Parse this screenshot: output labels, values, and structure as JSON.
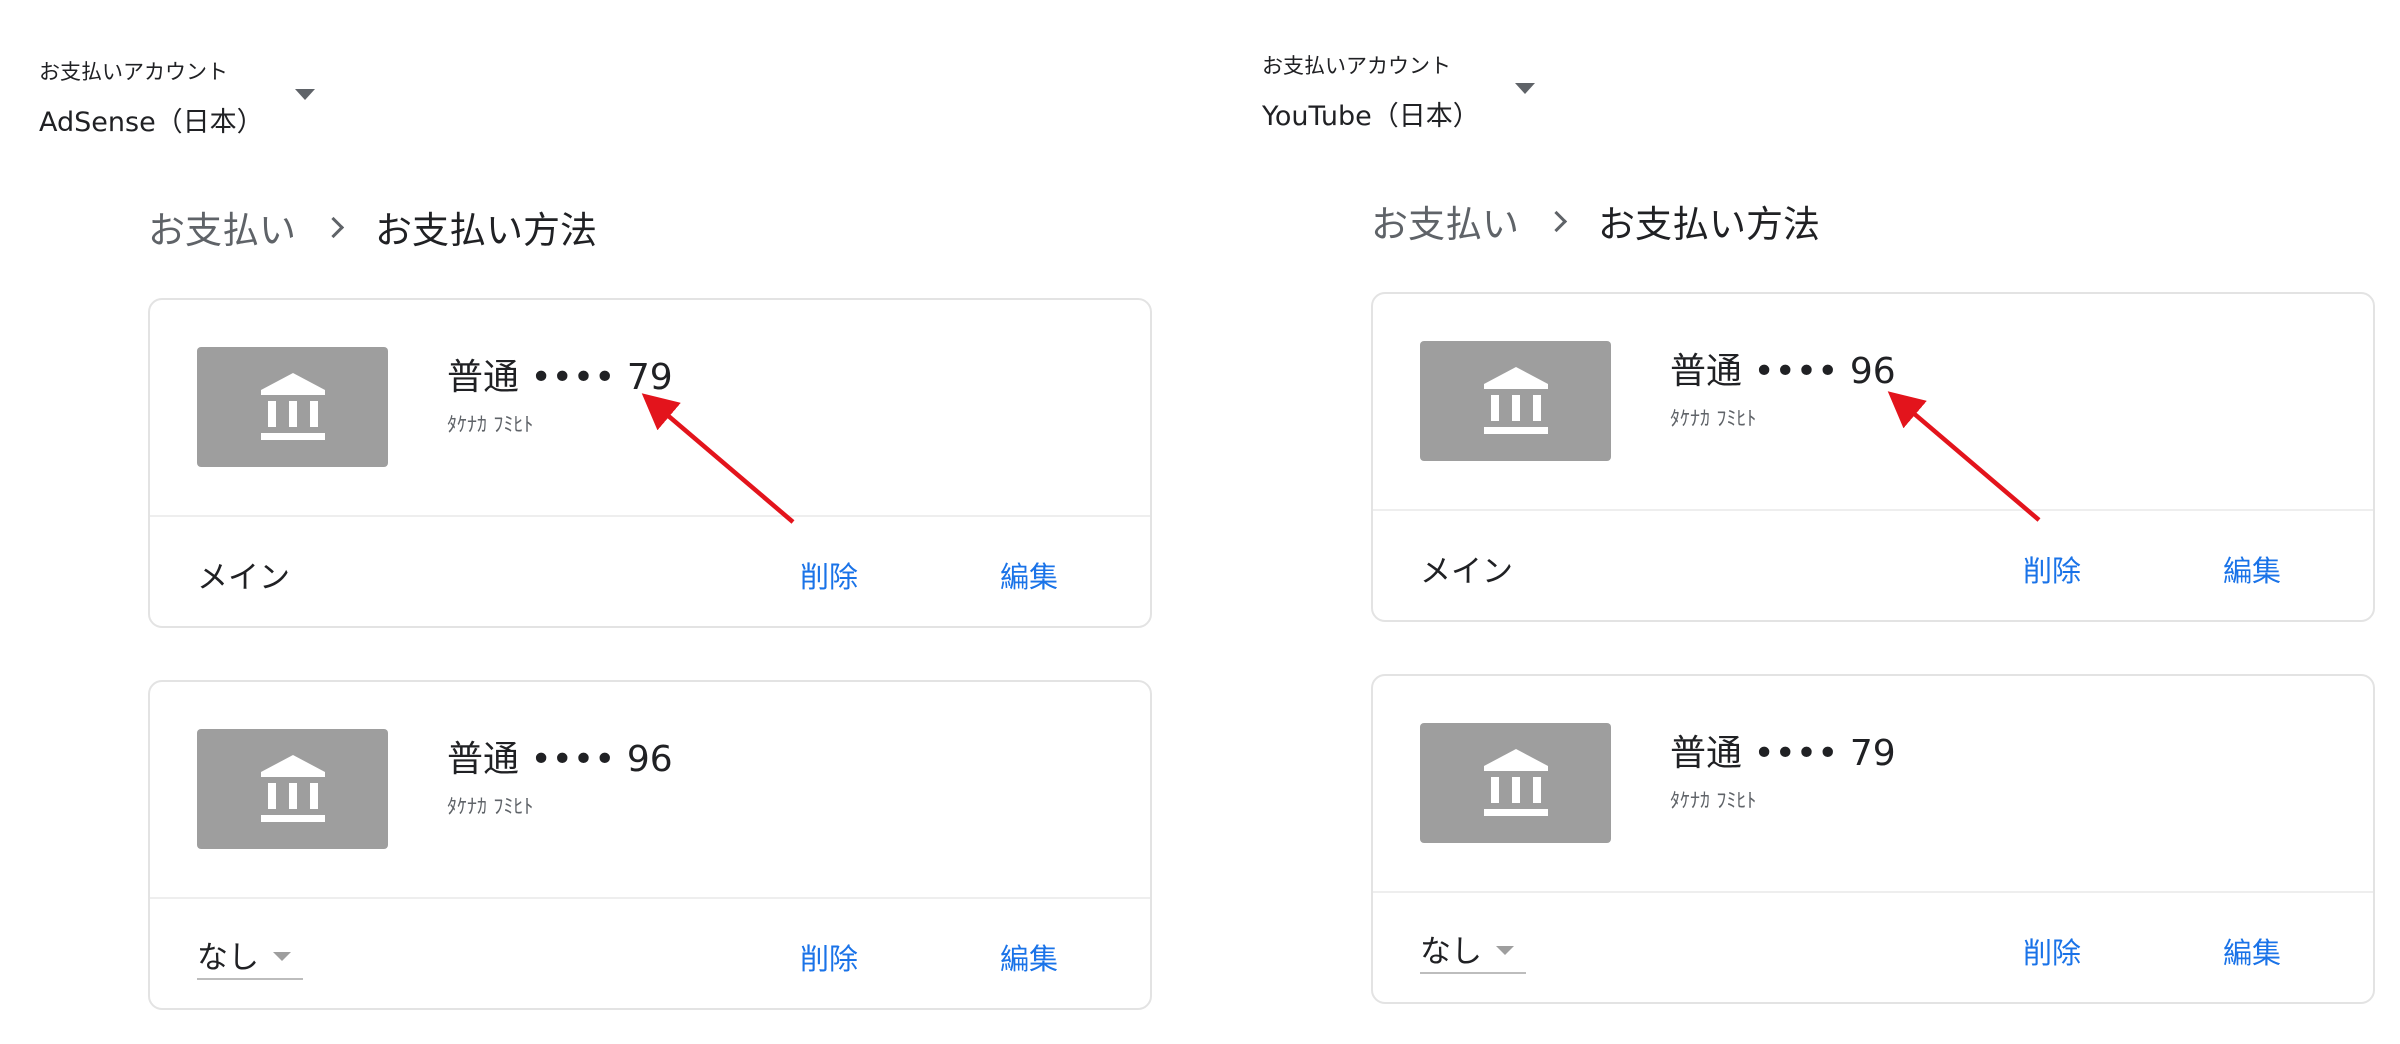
{
  "panels": [
    {
      "account_label": "お支払いアカウント",
      "account_value": "AdSense（日本）",
      "breadcrumb_root": "お支払い",
      "breadcrumb_current": "お支払い方法",
      "cards": [
        {
          "account": "普通 •••• 79",
          "holder": "ﾀｹﾅｶ ﾌﾐﾋﾄ",
          "status": "メイン",
          "delete_label": "削除",
          "edit_label": "編集"
        },
        {
          "account": "普通 •••• 96",
          "holder": "ﾀｹﾅｶ ﾌﾐﾋﾄ",
          "status": "なし",
          "delete_label": "削除",
          "edit_label": "編集"
        }
      ]
    },
    {
      "account_label": "お支払いアカウント",
      "account_value": "YouTube（日本）",
      "breadcrumb_root": "お支払い",
      "breadcrumb_current": "お支払い方法",
      "cards": [
        {
          "account": "普通 •••• 96",
          "holder": "ﾀｹﾅｶ ﾌﾐﾋﾄ",
          "status": "メイン",
          "delete_label": "削除",
          "edit_label": "編集"
        },
        {
          "account": "普通 •••• 79",
          "holder": "ﾀｹﾅｶ ﾌﾐﾋﾄ",
          "status": "なし",
          "delete_label": "削除",
          "edit_label": "編集"
        }
      ]
    }
  ],
  "icons": {
    "bank": "bank-icon",
    "dropdown": "dropdown-arrow-icon",
    "breadcrumb_separator": "chevron-right-icon",
    "annotation": "red-arrow-annotation"
  },
  "colors": {
    "link": "#1a73e8",
    "bank_tile": "#9e9e9e",
    "annotation_arrow": "#e3141c"
  }
}
